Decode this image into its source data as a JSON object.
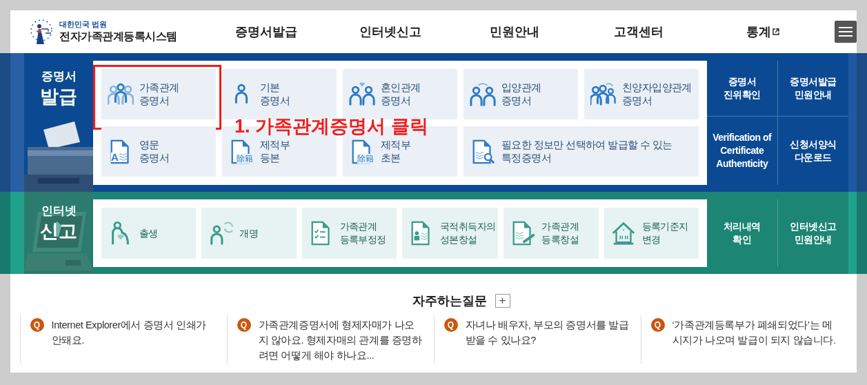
{
  "header": {
    "org": "대한민국 법원",
    "title": "전자가족관계등록시스템",
    "nav": [
      {
        "label": "증명서발급",
        "external": false
      },
      {
        "label": "인터넷신고",
        "external": false
      },
      {
        "label": "민원안내",
        "external": false
      },
      {
        "label": "고객센터",
        "external": false
      },
      {
        "label": "통계",
        "external": true
      }
    ]
  },
  "issue_section": {
    "heading_top": "증명서",
    "heading_main": "발급",
    "tiles": [
      {
        "kind": "family",
        "label": "가족관계\n증명서",
        "wide": false,
        "highlighted": true
      },
      {
        "kind": "person",
        "label": "기본\n증명서",
        "wide": false,
        "highlighted": false
      },
      {
        "kind": "couple",
        "label": "혼인관계\n증명서",
        "wide": false,
        "highlighted": false
      },
      {
        "kind": "adoption",
        "label": "입양관계\n증명서",
        "wide": false,
        "highlighted": false
      },
      {
        "kind": "family-adoption",
        "label": "친양자입양관계\n증명서",
        "wide": false,
        "highlighted": false
      },
      {
        "kind": "english-doc",
        "icon_text": "A",
        "label": "영문\n증명서",
        "wide": false,
        "highlighted": false
      },
      {
        "kind": "stamp-doc",
        "icon_text": "除籍",
        "label": "제적부\n등본",
        "wide": false,
        "highlighted": false
      },
      {
        "kind": "stamp-doc",
        "icon_text": "除籍",
        "label": "제적부\n초본",
        "wide": false,
        "highlighted": false
      },
      {
        "kind": "search-doc",
        "label": "필요한 정보만 선택하여 발급할 수 있는\n특정증명서",
        "wide": true,
        "highlighted": false
      }
    ],
    "links": [
      "증명서\n진위확인",
      "증명서발급\n민원안내",
      "Verification of\nCertificate\nAuthenticity",
      "신청서양식\n다운로드"
    ]
  },
  "annotation": {
    "text": "1. 가족관계증명서 클릭"
  },
  "report_section": {
    "heading_top": "인터넷",
    "heading_main": "신고",
    "tiles": [
      {
        "kind": "birth",
        "label": "출생"
      },
      {
        "kind": "rename",
        "label": "개명"
      },
      {
        "kind": "checklist-doc",
        "label": "가족관계\n등록부정정"
      },
      {
        "kind": "id-doc",
        "label": "국적취득자의\n성본창설"
      },
      {
        "kind": "write-doc",
        "label": "가족관계\n등록창설"
      },
      {
        "kind": "house",
        "label": "등록기준지\n변경"
      }
    ],
    "links": [
      "처리내역\n확인",
      "인터넷신고\n민원안내"
    ]
  },
  "faq": {
    "title": "자주하는질문",
    "more": "+",
    "items": [
      {
        "badge": "Q",
        "text": "Internet Explorer에서 증명서 인쇄가 안돼요."
      },
      {
        "badge": "Q",
        "text": "가족관계증명서에 형제자매가 나오지 않아요. 형제자매의 관계를 증명하려면 어떻게 해야 하나요..."
      },
      {
        "badge": "Q",
        "text": "자녀나 배우자, 부모의 증명서를 발급 받을 수 있나요?"
      },
      {
        "badge": "Q",
        "text": "‘가족관계등록부가 폐쇄되었다’는 메시지가 나오며 발급이 되지 않습니다."
      }
    ]
  }
}
